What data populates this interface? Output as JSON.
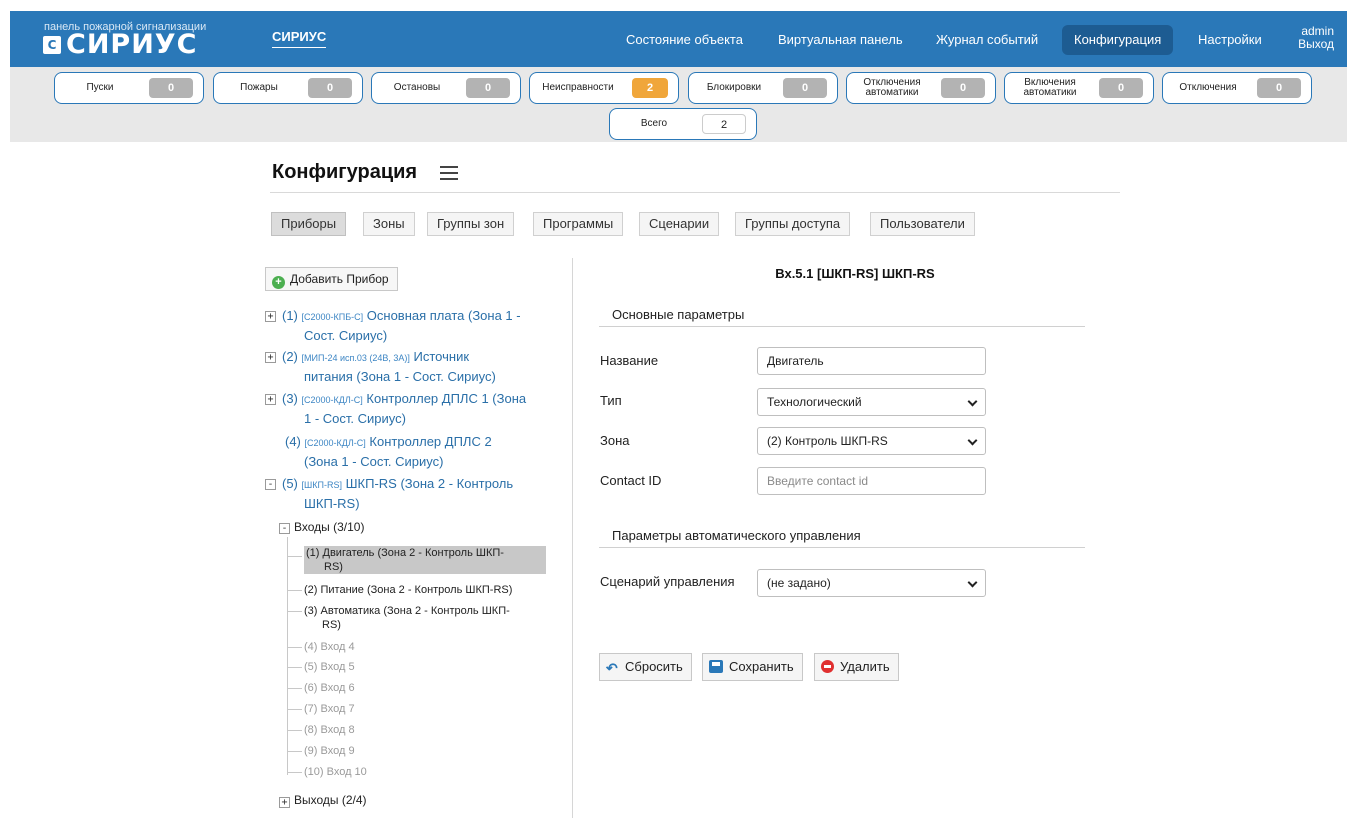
{
  "header": {
    "logo_caption": "панель пожарной сигнализации",
    "logo_text": "СИРИУС",
    "brand_link": "СИРИУС",
    "nav": [
      "Состояние объекта",
      "Виртуальная панель",
      "Журнал событий",
      "Конфигурация",
      "Настройки"
    ],
    "active_nav": "Конфигурация",
    "user": "admin",
    "logout": "Выход",
    "accent_color": "#2a78b8"
  },
  "counters": [
    {
      "label": "Пуски",
      "value": "0"
    },
    {
      "label": "Пожары",
      "value": "0"
    },
    {
      "label": "Останов​ы",
      "value": "0"
    },
    {
      "label": "Неисправности",
      "value": "2",
      "state": "warning"
    },
    {
      "label": "Блокировки",
      "value": "0"
    },
    {
      "label": "Отключения автоматики",
      "value": "0"
    },
    {
      "label": "Включения автоматики",
      "value": "0"
    },
    {
      "label": "Отключения",
      "value": "0"
    }
  ],
  "total": {
    "label": "Всего",
    "value": "2"
  },
  "page": {
    "title": "Конфигурация",
    "tabs": [
      "Приборы",
      "Зоны",
      "Группы зон",
      "Программы",
      "Сценарии",
      "Группы доступа",
      "Пользователи"
    ],
    "active_tab": "Приборы"
  },
  "tree": {
    "add_button": "Добавить Прибор",
    "devices": [
      {
        "num": "(1)",
        "code": "[С2000-КПБ-С]",
        "name": "Основная плата (Зона 1 -",
        "name2": "Сост. Сириус)",
        "toggle": "+"
      },
      {
        "num": "(2)",
        "code": "[МИП-24 исп.03 (24В, 3А)]",
        "name": "Источник",
        "name2": "питания (Зона 1 - Сост. Сириус)",
        "toggle": "+"
      },
      {
        "num": "(3)",
        "code": "[С2000-КДЛ-С]",
        "name": "Контроллер ДПЛС 1 (Зона",
        "name2": "1 - Сост. Сириус)",
        "toggle": "+"
      },
      {
        "num": "(4)",
        "code": "[С2000-КДЛ-С]",
        "name": "Контроллер ДПЛС 2",
        "name2": "(Зона 1 - Сост. Сириус)",
        "toggle": ""
      },
      {
        "num": "(5)",
        "code": "[ШКП-RS]",
        "name": "ШКП-RS (Зона 2 - Контроль",
        "name2": "ШКП-RS)",
        "toggle": "-"
      }
    ],
    "inputs_group": "Входы (3/10)",
    "inputs": [
      {
        "l1": "(1) Двигатель (Зона 2 - Контроль ШКП-",
        "l2": "RS)",
        "state": "selected"
      },
      {
        "l1": "(2) Питание (Зона 2 - Контроль ШКП-RS)",
        "l2": "",
        "state": "normal"
      },
      {
        "l1": "(3) Автоматика (Зона 2 - Контроль ШКП-",
        "l2": "RS)",
        "state": "normal"
      },
      {
        "l1": "(4) Вход 4",
        "l2": "",
        "state": "disabled"
      },
      {
        "l1": "(5) Вход 5",
        "l2": "",
        "state": "disabled"
      },
      {
        "l1": "(6) Вход 6",
        "l2": "",
        "state": "disabled"
      },
      {
        "l1": "(7) Вход 7",
        "l2": "",
        "state": "disabled"
      },
      {
        "l1": "(8) Вход 8",
        "l2": "",
        "state": "disabled"
      },
      {
        "l1": "(9) Вход 9",
        "l2": "",
        "state": "disabled"
      },
      {
        "l1": "(10) Вход 10",
        "l2": "",
        "state": "disabled"
      }
    ],
    "outputs_group": "Выходы (2/4)"
  },
  "form": {
    "title": "Вх.5.1 [ШКП-RS] ШКП-RS",
    "section_main": "Основные параметры",
    "name_label": "Название",
    "name_value": "Двигатель",
    "type_label": "Тип",
    "type_value": "Технологический",
    "zone_label": "Зона",
    "zone_value": "(2) Контроль ШКП-RS",
    "cid_label": "Contact ID",
    "cid_placeholder": "Введите contact id",
    "section_auto": "Параметры автоматического управления",
    "scenario_label": "Сценарий управления",
    "scenario_value": "(не задано)",
    "reset": "Сбросить",
    "save": "Сохранить",
    "delete": "Удалить"
  }
}
